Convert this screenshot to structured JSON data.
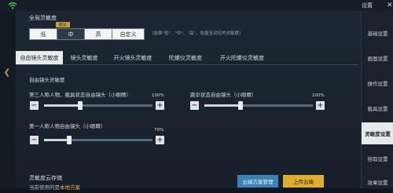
{
  "header": {
    "top_right_label": "设置",
    "close_glyph": "✕"
  },
  "sidebar": {
    "items": [
      {
        "label": "基础设置"
      },
      {
        "label": "画面设置"
      },
      {
        "label": "操作设置"
      },
      {
        "label": "载具设置"
      },
      {
        "label": "灵敏度设置"
      },
      {
        "label": "拾取设置"
      },
      {
        "label": "效果设置"
      }
    ],
    "active_index": 4
  },
  "global": {
    "label": "全局灵敏度",
    "options": [
      "低",
      "中",
      "高",
      "自定义"
    ],
    "selected": "中",
    "default_tag": "默认",
    "hint": "（选择\"低\"、\"中\"、\"高\"，恢复至对应的灵敏度）"
  },
  "tabs": {
    "items": [
      "自由镜头灵敏度",
      "镜头灵敏度",
      "开火镜头灵敏度",
      "陀螺仪灵敏度",
      "开火陀螺仪灵敏度"
    ],
    "active_index": 0
  },
  "section": {
    "label": "自由镜头灵敏度"
  },
  "sliders": [
    {
      "label": "第三人称人物、载具状态自由镜头（小眼睛）",
      "value_text": "100%",
      "value": 100,
      "max": 300
    },
    {
      "label": "跳伞状态自由镜头（小眼睛）",
      "value_text": "100%",
      "value": 100,
      "max": 300
    },
    {
      "label": "第一人称人物自由镜头（小眼睛）",
      "value_text": "70%",
      "value": 70,
      "max": 300
    }
  ],
  "cloud": {
    "title": "灵敏度云存储",
    "current_prefix": "当前使用的是",
    "current_value": "本地方案",
    "manage_label": "云端方案管理",
    "upload_label": "上传云端"
  },
  "icons": {
    "minus": "−",
    "plus": "+",
    "edge_arrow": "❮"
  },
  "colors": {
    "accent_gold": "#e0ad2e",
    "accent_blue": "#3b82b5"
  }
}
